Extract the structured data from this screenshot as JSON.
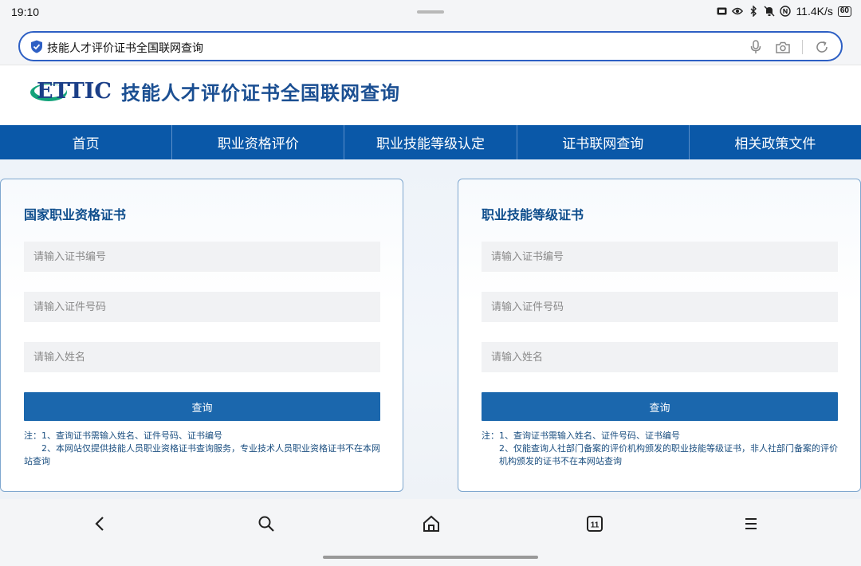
{
  "status": {
    "time": "19:10",
    "speed": "11.4K/s",
    "battery": "60",
    "icons": [
      "sim-icon",
      "eye-icon",
      "bluetooth-icon",
      "mute-icon",
      "nfc-icon"
    ]
  },
  "browser": {
    "address_text": "技能人才评价证书全国联网查询",
    "icons": [
      "shield-icon",
      "mic-icon",
      "camera-icon",
      "refresh-icon"
    ]
  },
  "site": {
    "logo_text": "ETTIC",
    "title": "技能人才评价证书全国联网查询"
  },
  "nav": {
    "items": [
      {
        "label": "首页"
      },
      {
        "label": "职业资格评价"
      },
      {
        "label": "职业技能等级认定"
      },
      {
        "label": "证书联网查询"
      },
      {
        "label": "相关政策文件"
      }
    ]
  },
  "cards": [
    {
      "title": "国家职业资格证书",
      "placeholders": [
        "请输入证书编号",
        "请输入证件号码",
        "请输入姓名"
      ],
      "button": "查询",
      "note_line1": "注：1、查询证书需输入姓名、证件号码、证书编号",
      "note_line2": "2、本网站仅提供技能人员职业资格证书查询服务，专业技术人员职业资格证书不在本网",
      "note_line3": "站查询"
    },
    {
      "title": "职业技能等级证书",
      "placeholders": [
        "请输入证书编号",
        "请输入证件号码",
        "请输入姓名"
      ],
      "button": "查询",
      "note_line1": "注：1、查询证书需输入姓名、证件号码、证书编号",
      "note_line2": "2、仅能查询人社部门备案的评价机构颁发的职业技能等级证书，非人社部门备案的评价",
      "note_line3": "机构颁发的证书不在本网站查询"
    }
  ],
  "bottom_nav": {
    "tab_count": "11",
    "icons": [
      "back-icon",
      "search-icon",
      "home-icon",
      "tabs-icon",
      "menu-icon"
    ]
  },
  "colors": {
    "nav_bg": "#0a58a8",
    "title_blue": "#1b4f92",
    "button_blue": "#1b67ad",
    "card_border": "#7fa7cf"
  }
}
